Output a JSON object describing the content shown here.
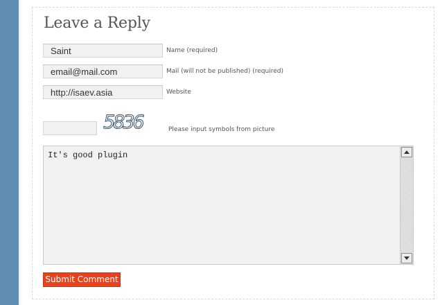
{
  "form": {
    "title": "Leave a Reply",
    "name": {
      "value": "Saint",
      "label": "Name (required)"
    },
    "email": {
      "value": "email@mail.com",
      "label": "Mail (will not be published) (required)"
    },
    "website": {
      "value": "http://isaev.asia",
      "label": "Website"
    },
    "captcha": {
      "value": "",
      "image_text": "5836",
      "label": "Please input symbols from picture"
    },
    "comment": {
      "value": "It's good plugin"
    },
    "submit_label": "Submit Comment"
  },
  "colors": {
    "sidebar": "#5f8db0",
    "submit_bg": "#e8411b",
    "field_bg": "#f1f1f1",
    "border_dashed": "#d9d9d9"
  },
  "icons": {
    "scroll_up": "arrow-up-icon",
    "scroll_down": "arrow-down-icon"
  }
}
